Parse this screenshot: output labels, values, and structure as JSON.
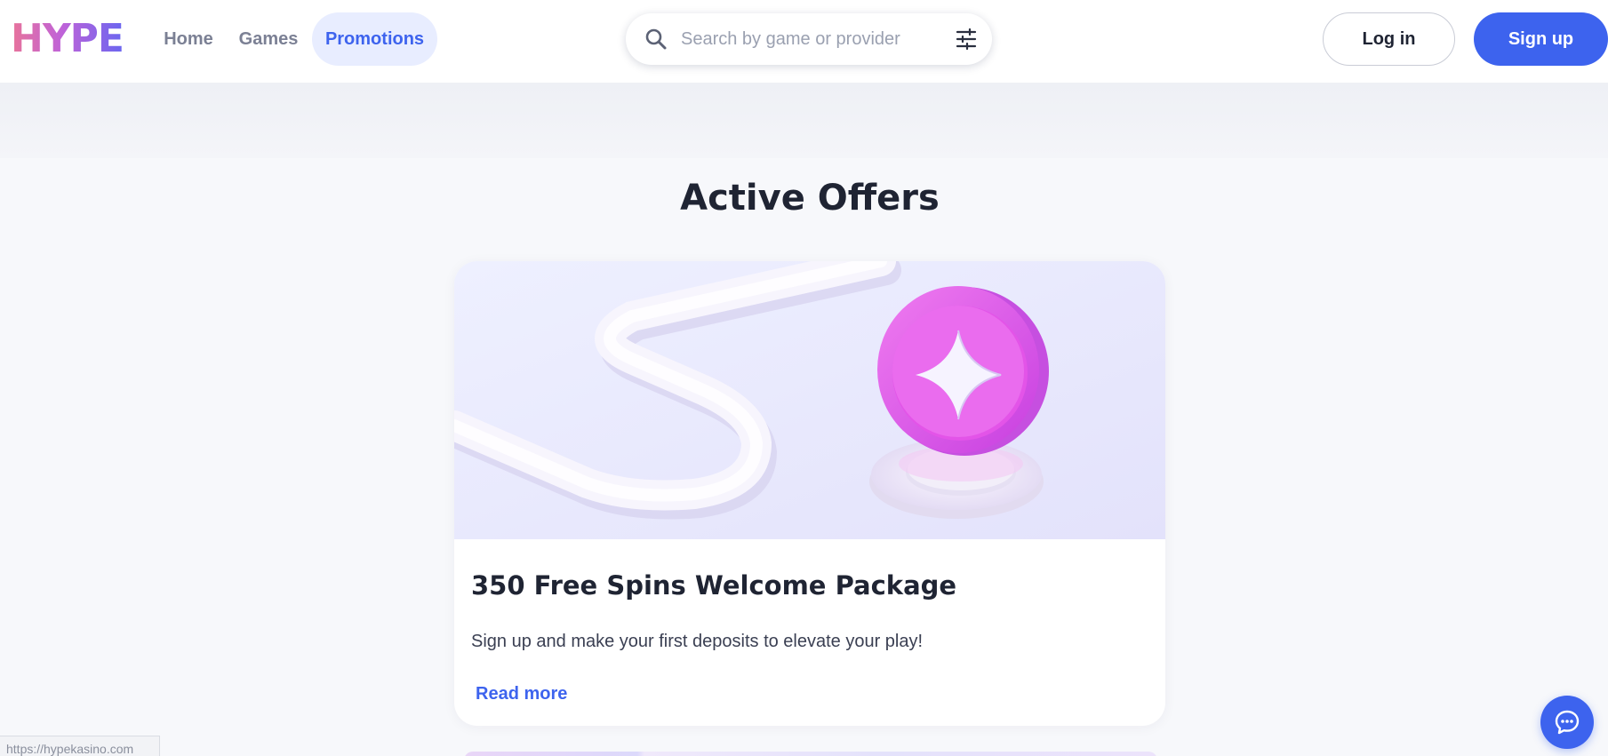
{
  "header": {
    "logo": "HYPE",
    "nav": [
      {
        "label": "Home"
      },
      {
        "label": "Games"
      },
      {
        "label": "Promotions",
        "active": true
      }
    ],
    "search": {
      "placeholder": "Search by game or provider",
      "value": ""
    },
    "login_label": "Log in",
    "signup_label": "Sign up"
  },
  "main": {
    "section_title": "Active Offers",
    "offers": [
      {
        "title": "350 Free Spins Welcome Package",
        "description": "Sign up and make your first deposits to elevate your play!",
        "link_label": "Read more"
      }
    ]
  },
  "status_bar": {
    "url": "https://hypekasino.com"
  },
  "icons": {
    "search": "search-icon",
    "filter": "filter-sliders-icon",
    "chat": "chat-bubble-icon"
  },
  "colors": {
    "accent": "#3d63ee",
    "active_nav_bg": "#e8edff",
    "coin": "#e25be8",
    "page_bg": "#f7f8fb"
  }
}
